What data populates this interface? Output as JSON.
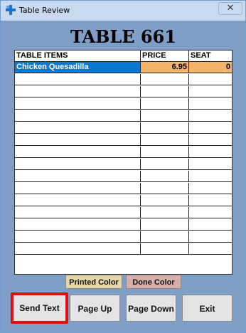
{
  "window": {
    "title": "Table Review",
    "close_label": "✕"
  },
  "table_title": "TABLE 661",
  "grid": {
    "headers": {
      "item": "TABLE ITEMS",
      "price": "PRICE",
      "seat": "SEAT"
    },
    "rows": [
      {
        "item": "Chicken Quesadilla",
        "price": "6.95",
        "seat": "0"
      }
    ],
    "empty_rows": 15,
    "colors": {
      "selected_item_bg": "#0a78d0",
      "selected_value_bg": "#f4b36a"
    }
  },
  "legend": {
    "printed": {
      "label": "Printed Color",
      "color": "#e4d6a7"
    },
    "done": {
      "label": "Done Color",
      "color": "#d8b0aa"
    }
  },
  "buttons": {
    "send_text": "Send Text",
    "page_up": "Page Up",
    "page_down": "Page Down",
    "exit": "Exit"
  },
  "icons": {
    "app": "app-cross-icon",
    "close": "close-icon"
  }
}
